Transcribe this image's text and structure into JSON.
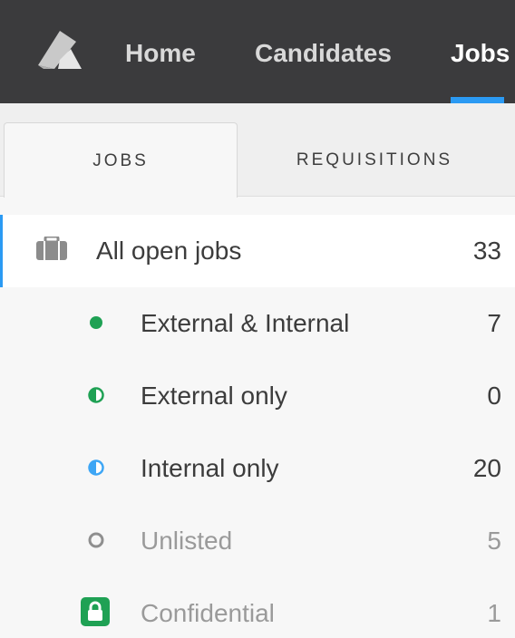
{
  "nav": {
    "items": [
      {
        "label": "Home"
      },
      {
        "label": "Candidates"
      },
      {
        "label": "Jobs"
      }
    ],
    "active": "Jobs",
    "accent_color": "#2b9af3",
    "logo_icon": "lever-logo-icon"
  },
  "tabs": [
    {
      "label": "JOBS",
      "active": true
    },
    {
      "label": "REQUISITIONS",
      "active": false
    }
  ],
  "job_list": {
    "items": [
      {
        "label": "All open jobs",
        "count": "33",
        "icon": "briefcase-icon"
      },
      {
        "label": "External & Internal",
        "count": "7",
        "icon": "filled-circle-icon",
        "icon_color": "#1fa154"
      },
      {
        "label": "External only",
        "count": "0",
        "icon": "half-filled-circle-icon",
        "icon_color": "#1fa154"
      },
      {
        "label": "Internal only",
        "count": "20",
        "icon": "half-filled-circle-icon",
        "icon_color": "#3ea6f5"
      },
      {
        "label": "Unlisted",
        "count": "5",
        "icon": "empty-circle-icon",
        "icon_color": "#8f8f8f"
      },
      {
        "label": "Confidential",
        "count": "1",
        "icon": "lock-icon",
        "icon_color": "#1fa154"
      }
    ]
  }
}
